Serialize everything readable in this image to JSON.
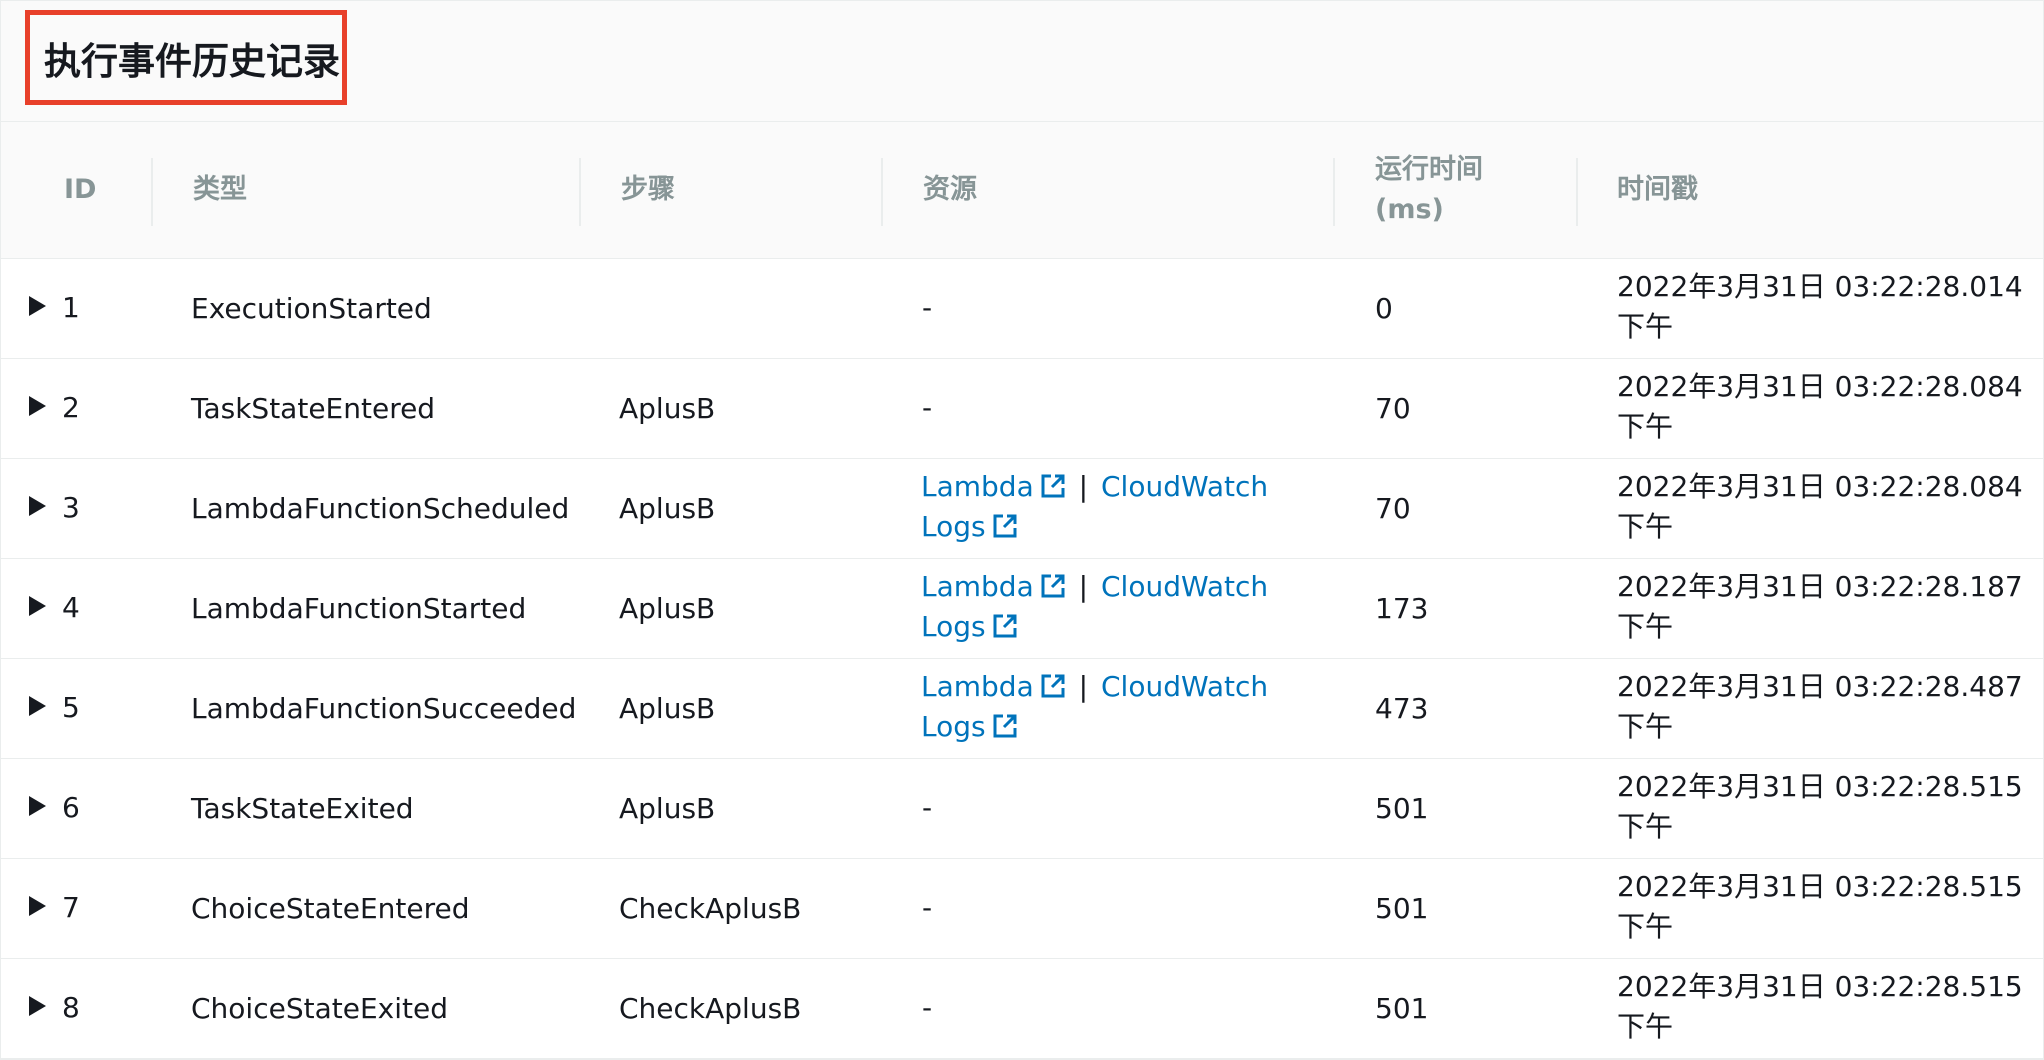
{
  "title": "执行事件历史记录",
  "columns": {
    "id": "ID",
    "type": "类型",
    "step": "步骤",
    "resource": "资源",
    "runtime_line1": "运行时间",
    "runtime_line2": "(ms)",
    "timestamp": "时间戳"
  },
  "resource_labels": {
    "lambda": "Lambda",
    "separator": "|",
    "cloudwatch": "CloudWatch",
    "logs": "Logs"
  },
  "icons": {
    "expand": "caret-right-icon",
    "external": "external-link-icon"
  },
  "colors": {
    "link": "#0073bb",
    "highlight_border": "#e8402a",
    "header_text": "#879596"
  },
  "rows": [
    {
      "id": "1",
      "type": "ExecutionStarted",
      "step": "",
      "resource": "-",
      "has_links": false,
      "runtime": "0",
      "ts_line1": "2022年3月31日 03:22:28.014",
      "ts_line2": "下午"
    },
    {
      "id": "2",
      "type": "TaskStateEntered",
      "step": "AplusB",
      "resource": "-",
      "has_links": false,
      "runtime": "70",
      "ts_line1": "2022年3月31日 03:22:28.084",
      "ts_line2": "下午"
    },
    {
      "id": "3",
      "type": "LambdaFunctionScheduled",
      "step": "AplusB",
      "resource": "",
      "has_links": true,
      "runtime": "70",
      "ts_line1": "2022年3月31日 03:22:28.084",
      "ts_line2": "下午"
    },
    {
      "id": "4",
      "type": "LambdaFunctionStarted",
      "step": "AplusB",
      "resource": "",
      "has_links": true,
      "runtime": "173",
      "ts_line1": "2022年3月31日 03:22:28.187",
      "ts_line2": "下午"
    },
    {
      "id": "5",
      "type": "LambdaFunctionSucceeded",
      "step": "AplusB",
      "resource": "",
      "has_links": true,
      "runtime": "473",
      "ts_line1": "2022年3月31日 03:22:28.487",
      "ts_line2": "下午"
    },
    {
      "id": "6",
      "type": "TaskStateExited",
      "step": "AplusB",
      "resource": "-",
      "has_links": false,
      "runtime": "501",
      "ts_line1": "2022年3月31日 03:22:28.515",
      "ts_line2": "下午"
    },
    {
      "id": "7",
      "type": "ChoiceStateEntered",
      "step": "CheckAplusB",
      "resource": "-",
      "has_links": false,
      "runtime": "501",
      "ts_line1": "2022年3月31日 03:22:28.515",
      "ts_line2": "下午"
    },
    {
      "id": "8",
      "type": "ChoiceStateExited",
      "step": "CheckAplusB",
      "resource": "-",
      "has_links": false,
      "runtime": "501",
      "ts_line1": "2022年3月31日 03:22:28.515",
      "ts_line2": "下午"
    }
  ]
}
